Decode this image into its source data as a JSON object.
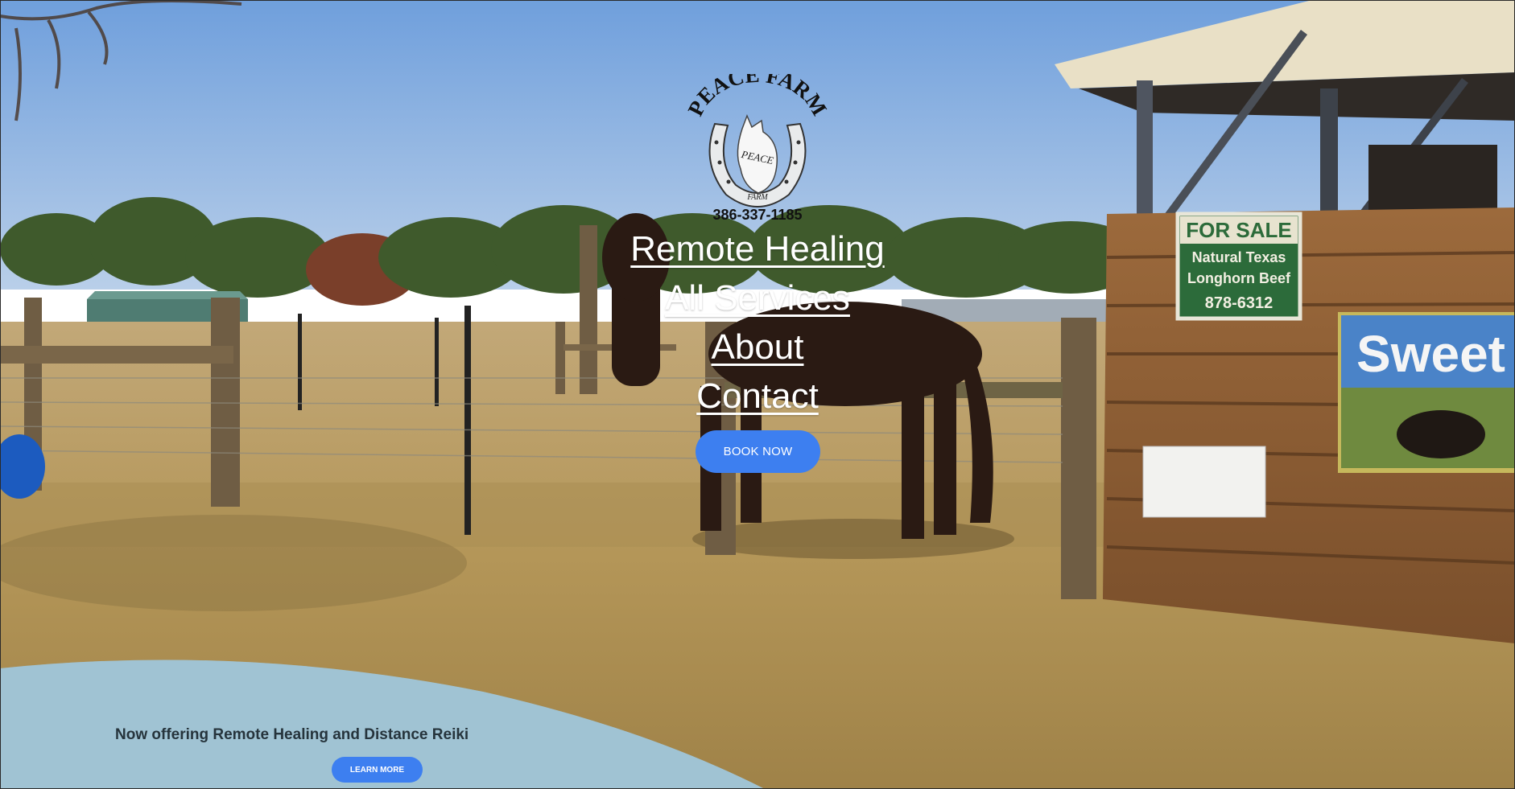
{
  "brand": {
    "logo_arc_text": "PEACE FARM",
    "logo_badge_text": "PEACE",
    "logo_bottom_text": "FARM",
    "phone": "386-337-1185"
  },
  "nav": {
    "items": [
      "Remote Healing",
      "All Services",
      "About",
      "Contact"
    ]
  },
  "cta": {
    "book_label": "BOOK NOW"
  },
  "banner": {
    "text": "Now offering Remote Healing and Distance Reiki",
    "learn_more_label": "LEARN MORE"
  },
  "scene_signs": {
    "for_sale": "FOR SALE",
    "beef_line1": "Natural Texas",
    "beef_line2": "Longhorn Beef",
    "beef_phone": "878-6312",
    "sweet_sign": "Sweet"
  },
  "colors": {
    "accent_button": "#3d7ff0",
    "sky": "#8fb3e0",
    "grass": "#b59a5e",
    "banner_wave": "#9fc2d4"
  }
}
